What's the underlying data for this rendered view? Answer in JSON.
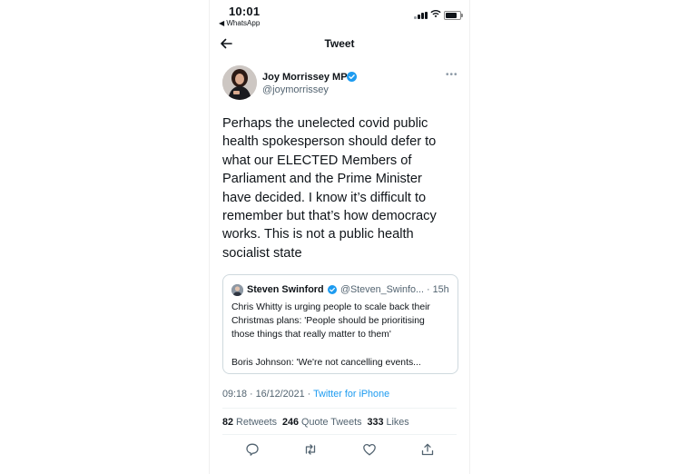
{
  "status_bar": {
    "time": "10:01",
    "back_app": "◀ WhatsApp"
  },
  "header": {
    "title": "Tweet"
  },
  "tweet": {
    "author_name": "Joy Morrissey MP",
    "author_handle": "@joymorrissey",
    "text_lines": [
      "Perhaps the unelected covid public",
      "health spokesperson should defer to",
      "what our ELECTED Members of",
      "Parliament and the Prime Minister",
      "have decided. I know it’s difficult to",
      "remember but that’s how democracy",
      "works. This is not a public health",
      "socialist state"
    ],
    "time": "09:18 · 16/12/2021 · ",
    "source": "Twitter for iPhone"
  },
  "quoted_tweet": {
    "author_name": "Steven Swinford",
    "handle_and_time": "@Steven_Swinfo... · 15h",
    "lines": [
      "Chris Whitty is urging people to scale back their",
      "Christmas plans: 'People should be prioritising",
      "those things that really matter to them'",
      "",
      "Boris Johnson: 'We're not cancelling events..."
    ]
  },
  "stats": {
    "retweets_count": "82",
    "retweets_label": "Retweets",
    "quotes_count": "246",
    "quotes_label": "Quote Tweets",
    "likes_count": "333",
    "likes_label": "Likes"
  },
  "colors": {
    "accent": "#1d9bf0",
    "secondary_text": "#536471",
    "primary_text": "#0f1419",
    "border": "#cfd9de"
  },
  "icons": [
    "back-arrow-icon",
    "verified-badge-icon",
    "more-icon",
    "reply-icon",
    "retweet-icon",
    "like-icon",
    "share-icon"
  ]
}
